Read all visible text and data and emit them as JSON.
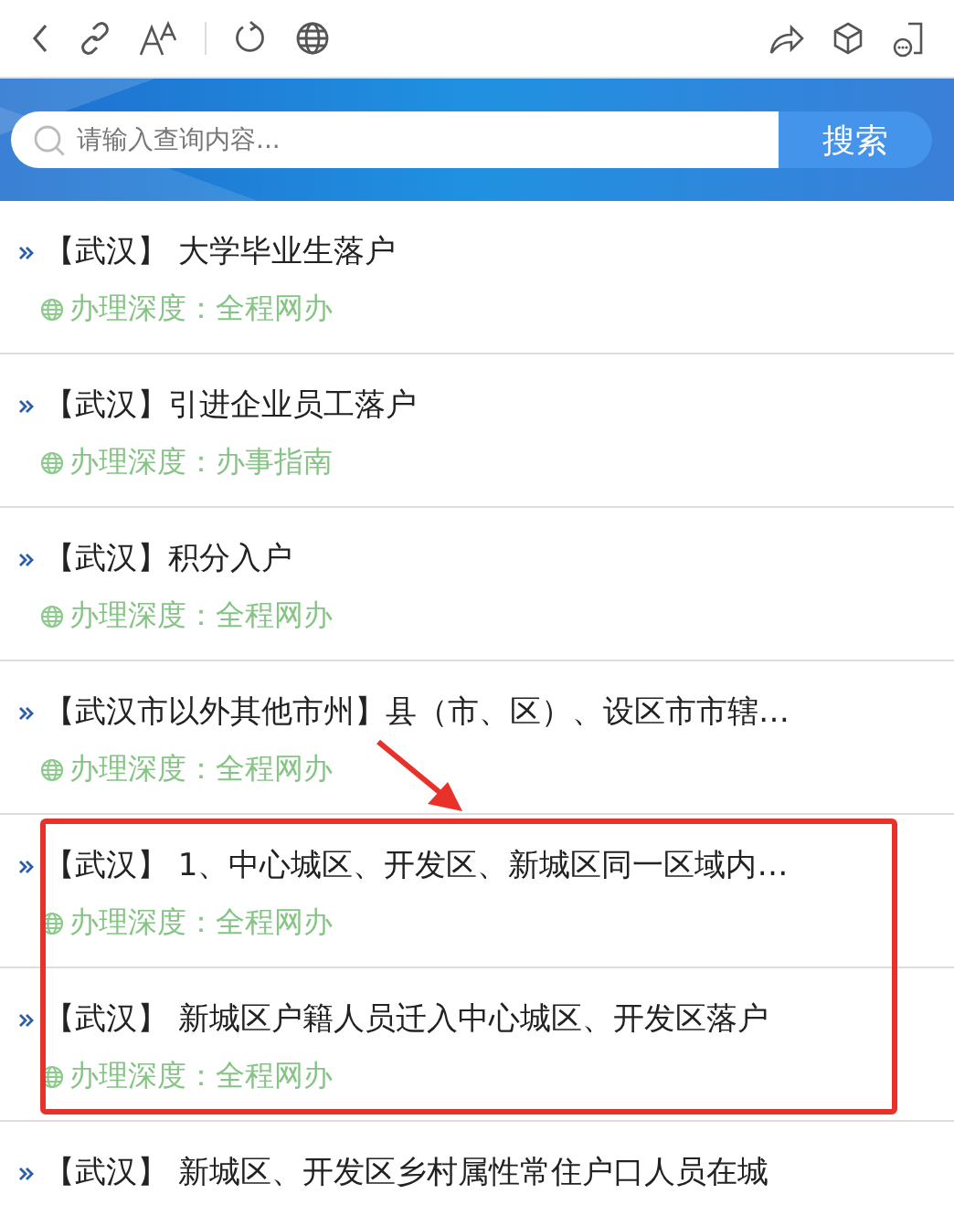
{
  "search": {
    "placeholder": "请输入查询内容...",
    "button": "搜索"
  },
  "items": [
    {
      "title": "【武汉】 大学毕业生落户",
      "depth": "办理深度：全程网办"
    },
    {
      "title": "【武汉】引进企业员工落户",
      "depth": "办理深度：办事指南"
    },
    {
      "title": "【武汉】积分入户",
      "depth": "办理深度：全程网办"
    },
    {
      "title": "【武汉市以外其他市州】县（市、区）、设区市市辖…",
      "depth": "办理深度：全程网办"
    },
    {
      "title": "【武汉】 1、中心城区、开发区、新城区同一区域内…",
      "depth": "办理深度：全程网办"
    },
    {
      "title": "【武汉】 新城区户籍人员迁入中心城区、开发区落户",
      "depth": "办理深度：全程网办"
    },
    {
      "title": "【武汉】 新城区、开发区乡村属性常住户口人员在城"
    }
  ],
  "annotations": [
    {
      "kind": "arrow"
    },
    {
      "kind": "box"
    }
  ]
}
